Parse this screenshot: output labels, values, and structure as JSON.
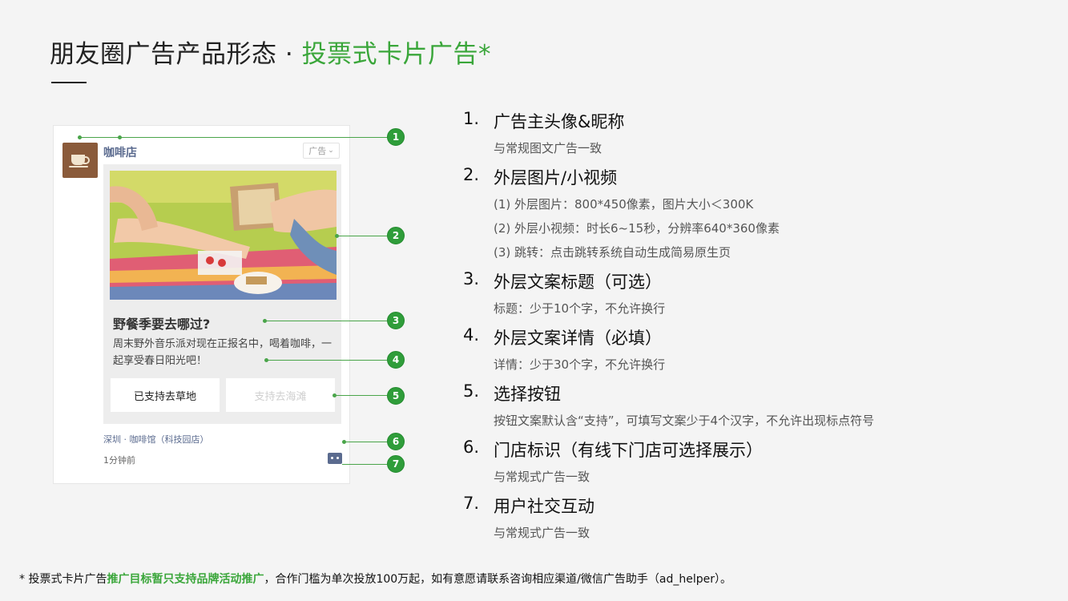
{
  "title": {
    "prefix": "朋友圈广告产品形态 · ",
    "highlight": "投票式卡片广告*"
  },
  "preview": {
    "nickname": "咖啡店",
    "ad_tag": "广告",
    "ad_tag_icon": "chevron-down-icon",
    "avatar_icon": "coffee-cup-icon",
    "card_title": "野餐季要去哪过?",
    "card_desc": "周末野外音乐派对现在正报名中，喝着咖啡，一起享受春日阳光吧！",
    "vote_options": [
      "已支持去草地",
      "支持去海滩"
    ],
    "location": "深圳 · 咖啡馆（科技园店）",
    "time": "1分钟前",
    "comment_icon": "comment-icon"
  },
  "callouts": [
    "1",
    "2",
    "3",
    "4",
    "5",
    "6",
    "7"
  ],
  "items": [
    {
      "num": "1.",
      "head": "广告主头像&昵称",
      "subs": [
        "与常规图文广告一致"
      ]
    },
    {
      "num": "2.",
      "head": "外层图片/小视频",
      "subs": [
        "(1) 外层图片：800*450像素，图片大小＜300K",
        "(2) 外层小视频：时长6~15秒，分辨率640*360像素",
        "(3) 跳转：点击跳转系统自动生成简易原生页"
      ]
    },
    {
      "num": "3.",
      "head": "外层文案标题（可选）",
      "subs": [
        "标题：少于10个字，不允许换行"
      ]
    },
    {
      "num": "4.",
      "head": "外层文案详情（必填）",
      "subs": [
        "详情：少于30个字，不允许换行"
      ]
    },
    {
      "num": "5.",
      "head": "选择按钮",
      "subs": [
        "按钮文案默认含“支持”，可填写文案少于4个汉字，不允许出现标点符号"
      ]
    },
    {
      "num": "6.",
      "head": "门店标识（有线下门店可选择展示）",
      "subs": [
        "与常规式广告一致"
      ]
    },
    {
      "num": "7.",
      "head": "用户社交互动",
      "subs": [
        "与常规式广告一致"
      ]
    }
  ],
  "footnote": {
    "part1": "* 投票式卡片广告",
    "highlight": "推广目标暂只支持品牌活动推广",
    "part2": "，合作门槛为单次投放100万起，如有意愿请联系咨询相应渠道/微信广告助手（ad_helper）。"
  },
  "colors": {
    "accent": "#3aa63a",
    "callout": "#2f9d3a",
    "link": "#5b6b8f"
  }
}
